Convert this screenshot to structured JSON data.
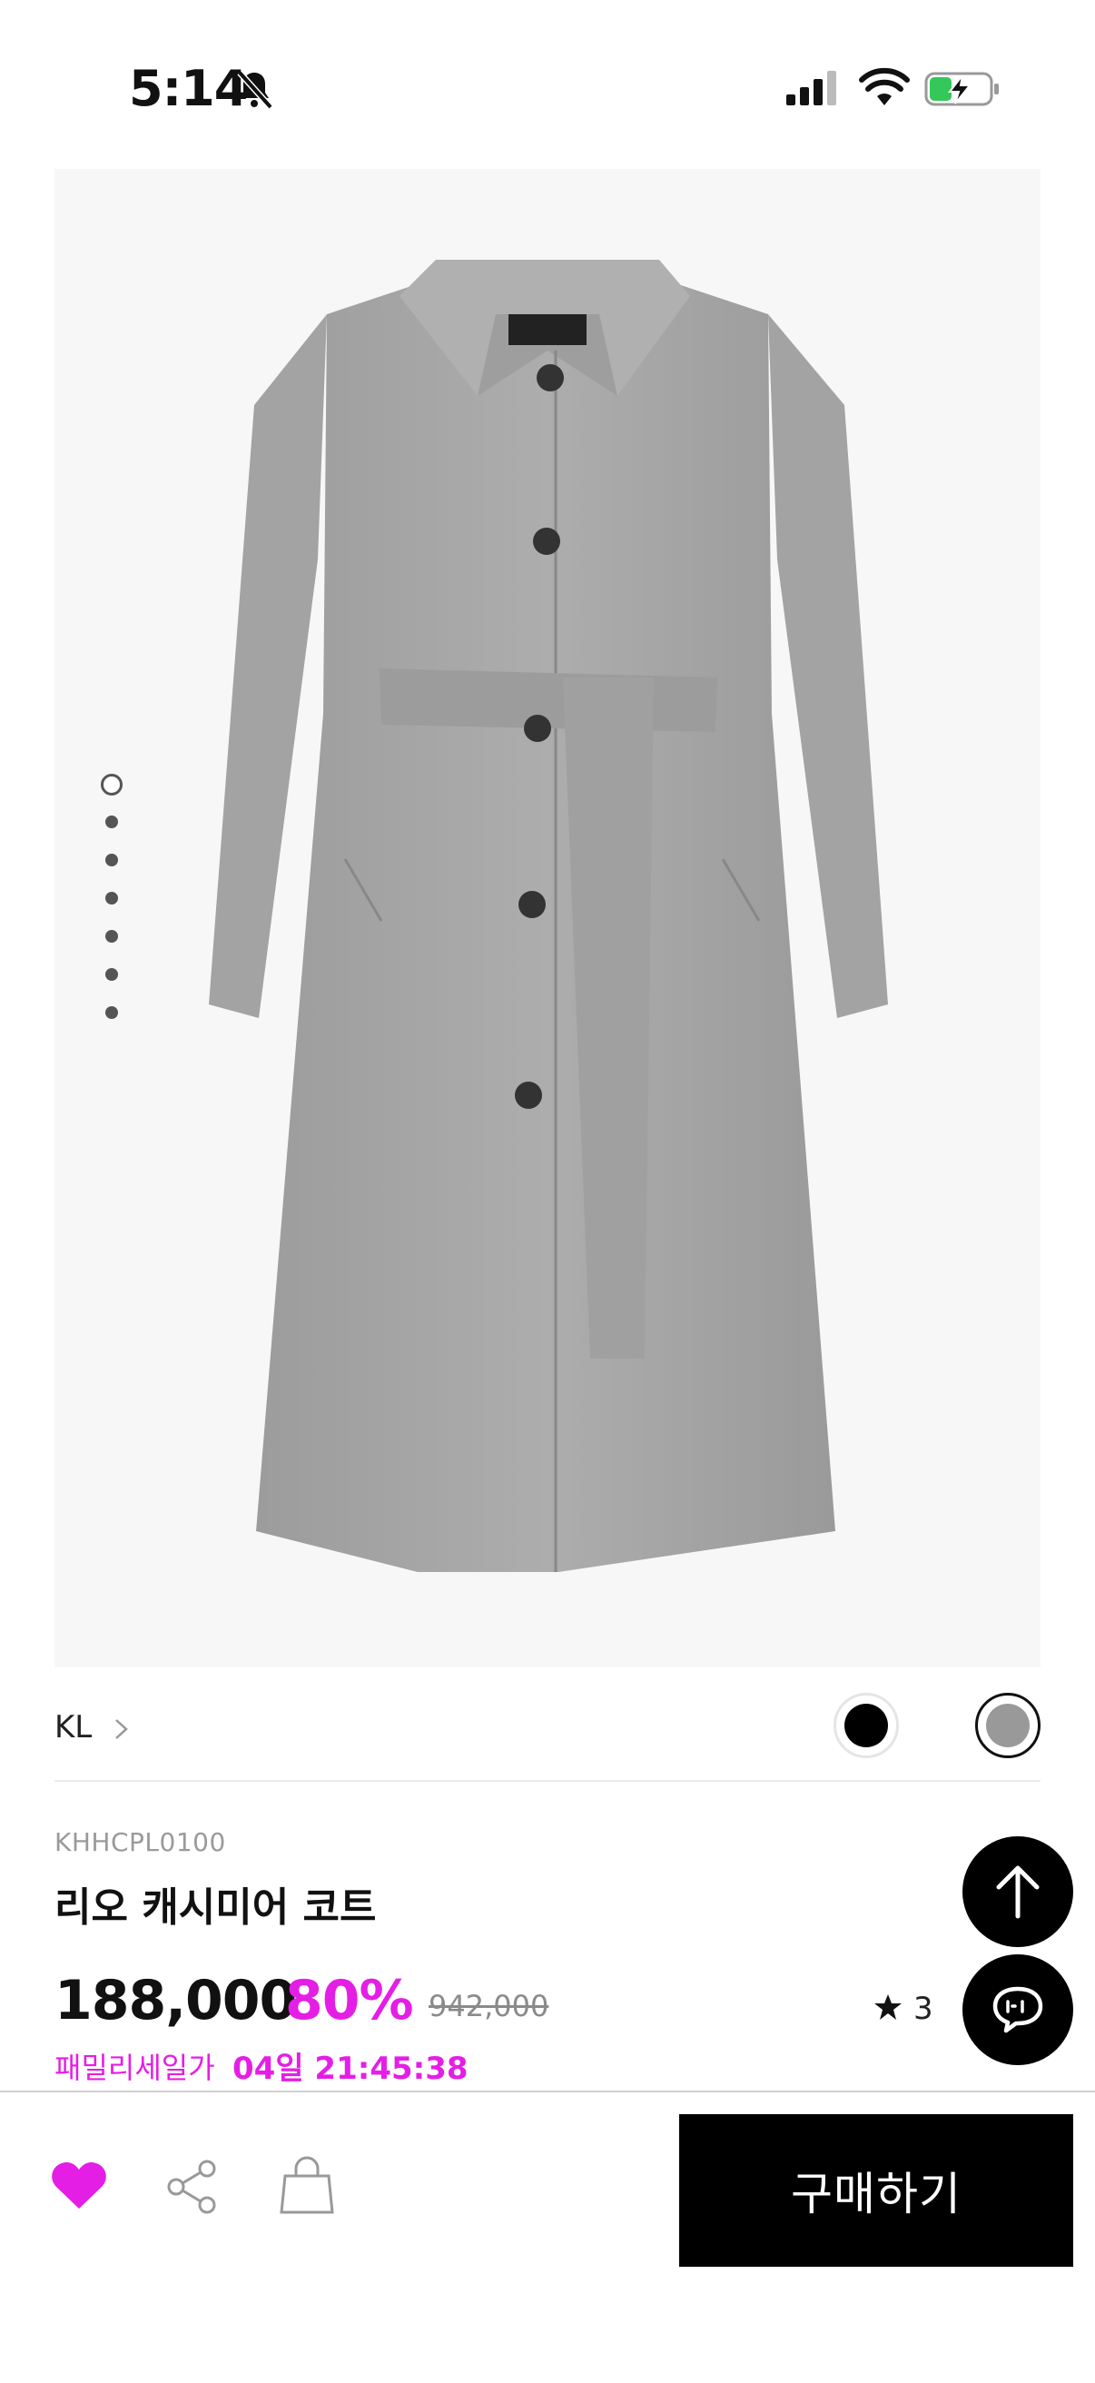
{
  "status_bar": {
    "time": "5:14",
    "icons": [
      "bell-slash-icon",
      "cellular-signal-icon",
      "wifi-icon",
      "battery-charging-icon"
    ]
  },
  "gallery": {
    "image": "grey-belted-wool-coat",
    "image_count": 7,
    "active_index": 0
  },
  "brand": {
    "name": "KL"
  },
  "colors": {
    "options": [
      {
        "name": "black",
        "hex": "#000000",
        "selected": false
      },
      {
        "name": "gray",
        "hex": "#999999",
        "selected": true
      }
    ]
  },
  "product": {
    "code": "KHHCPL0100",
    "title": "리오 캐시미어 코트",
    "price": "188,000",
    "discount": "80%",
    "original_price": "942,000",
    "sale_label": "패밀리세일가",
    "sale_countdown": "04일 21:45:38",
    "rating_count": "3"
  },
  "accent_color": "#e51ee6",
  "bottom_bar": {
    "buy_label": "구매하기"
  }
}
